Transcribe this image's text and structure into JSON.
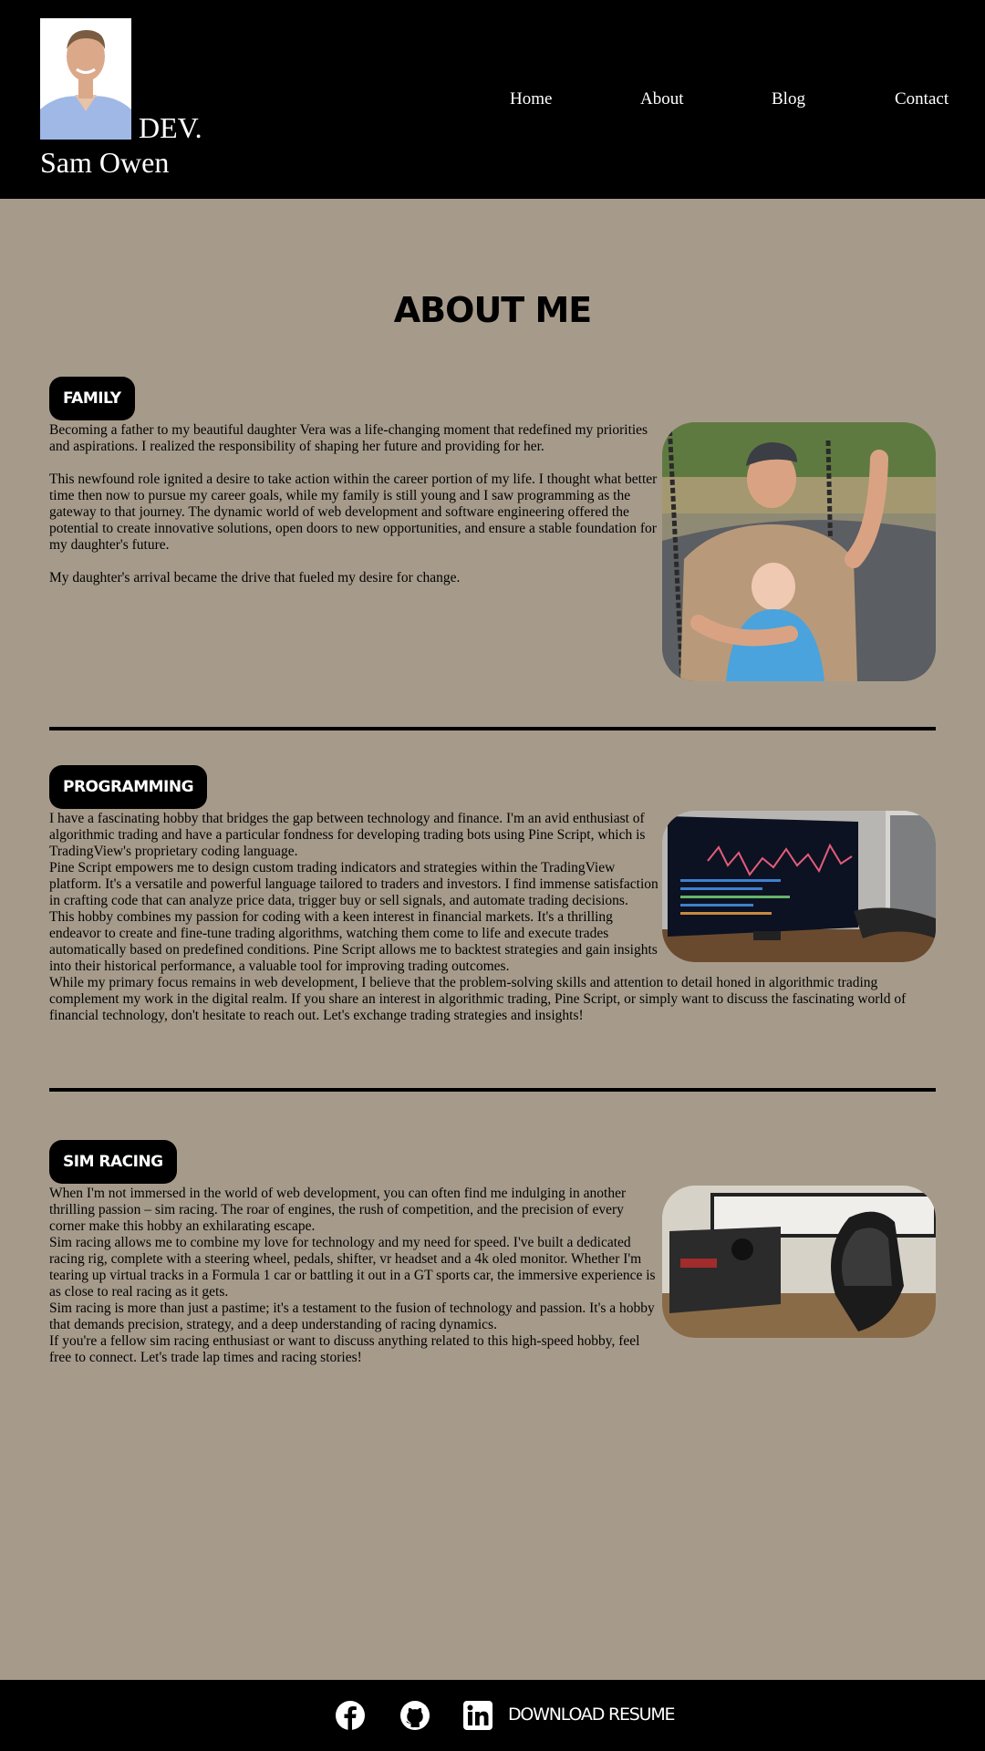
{
  "header": {
    "brand_dev": "DEV.",
    "brand_name": "Sam Owen",
    "nav": [
      "Home",
      "About",
      "Blog",
      "Contact"
    ]
  },
  "page_title": "ABOUT ME",
  "sections": [
    {
      "badge": "FAMILY",
      "paragraphs": [
        "Becoming a father to my beautiful daughter Vera was a life-changing moment that redefined my priorities and aspirations. I realized the responsibility of shaping her future and providing for her.",
        "This newfound role ignited a desire to take action within the career portion of my life. I thought what better time then now to pursue my career goals, while my family is still young and I saw programming as the gateway to that journey. The dynamic world of web development and software engineering offered the potential to create innovative solutions, open doors to new opportunities, and ensure a stable foundation for my daughter's future.",
        "My daughter's arrival became the drive that fueled my desire for change."
      ]
    },
    {
      "badge": "PROGRAMMING",
      "paragraphs": [
        "I have a fascinating hobby that bridges the gap between technology and finance. I'm an avid enthusiast of algorithmic trading and have a particular fondness for developing trading bots using Pine Script, which is TradingView's proprietary coding language.",
        "Pine Script empowers me to design custom trading indicators and strategies within the TradingView platform. It's a versatile and powerful language tailored to traders and investors. I find immense satisfaction in crafting code that can analyze price data, trigger buy or sell signals, and automate trading decisions.",
        "This hobby combines my passion for coding with a keen interest in financial markets. It's a thrilling endeavor to create and fine-tune trading algorithms, watching them come to life and execute trades automatically based on predefined conditions. Pine Script allows me to backtest strategies and gain insights into their historical performance, a valuable tool for improving trading outcomes.",
        "While my primary focus remains in web development, I believe that the problem-solving skills and attention to detail honed in algorithmic trading complement my work in the digital realm. If you share an interest in algorithmic trading, Pine Script, or simply want to discuss the fascinating world of financial technology, don't hesitate to reach out. Let's exchange trading strategies and insights!"
      ]
    },
    {
      "badge": "SIM RACING",
      "paragraphs": [
        "When I'm not immersed in the world of web development, you can often find me indulging in another thrilling passion – sim racing. The roar of engines, the rush of competition, and the precision of every corner make this hobby an exhilarating escape.",
        "Sim racing allows me to combine my love for technology and my need for speed. I've built a dedicated racing rig, complete with a steering wheel, pedals, shifter, vr headset and a 4k oled monitor. Whether I'm tearing up virtual tracks in a Formula 1 car or battling it out in a GT sports car, the immersive experience is as close to real racing as it gets.",
        "Sim racing is more than just a pastime; it's a testament to the fusion of technology and passion. It's a hobby that demands precision, strategy, and a deep understanding of racing dynamics.",
        "If you're a fellow sim racing enthusiast or want to discuss anything related to this high-speed hobby, feel free to connect. Let's trade lap times and racing stories!"
      ]
    }
  ],
  "footer": {
    "icons": [
      "facebook-icon",
      "github-icon",
      "linkedin-icon"
    ],
    "download_label": "DOWNLOAD RESUME"
  }
}
